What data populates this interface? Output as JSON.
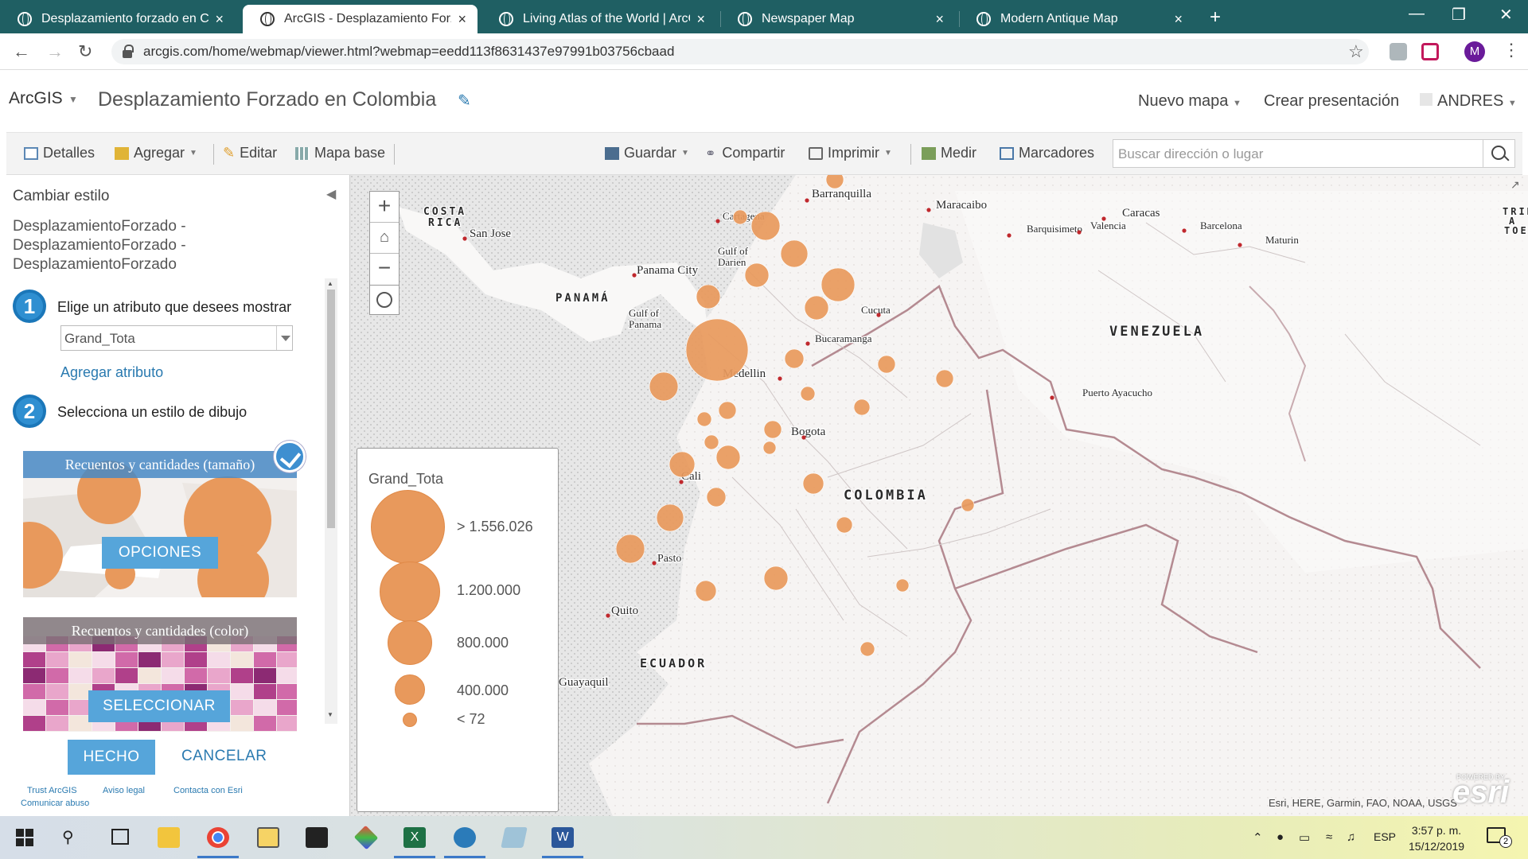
{
  "browser": {
    "tabs": [
      {
        "title": "Desplazamiento forzado en Colo",
        "close": "×",
        "active": false
      },
      {
        "title": "ArcGIS - Desplazamiento Forzado",
        "close": "×",
        "active": true
      },
      {
        "title": "Living Atlas of the World | ArcGIS",
        "close": "×",
        "active": false
      },
      {
        "title": "Newspaper Map",
        "close": "×",
        "active": false
      },
      {
        "title": "Modern Antique Map",
        "close": "×",
        "active": false
      }
    ],
    "new_tab": "+",
    "url": "arcgis.com/home/webmap/viewer.html?webmap=eedd113f8631437e97991b03756cbaad",
    "profile_initial": "M"
  },
  "header": {
    "logo": "ArcGIS",
    "title": "Desplazamiento Forzado en Colombia",
    "new_map": "Nuevo mapa",
    "create_presentation": "Crear presentación",
    "user": "ANDRES"
  },
  "toolbar": {
    "details": "Detalles",
    "add": "Agregar",
    "edit": "Editar",
    "basemap": "Mapa base",
    "save": "Guardar",
    "share": "Compartir",
    "print": "Imprimir",
    "measure": "Medir",
    "bookmarks": "Marcadores",
    "search_placeholder": "Buscar dirección o lugar"
  },
  "panel": {
    "title": "Cambiar estilo",
    "layer_lines": [
      "DesplazamientoForzado -",
      "DesplazamientoForzado -",
      "DesplazamientoForzado"
    ],
    "step1_num": "1",
    "step1_text": "Elige un atributo que desees mostrar",
    "attribute_value": "Grand_Tota",
    "add_attribute": "Agregar atributo",
    "step2_num": "2",
    "step2_text": "Selecciona un estilo de dibujo",
    "card1_label": "Recuentos y cantidades (tamaño)",
    "card1_button": "OPCIONES",
    "card2_label": "Recuentos y cantidades (color)",
    "card2_button": "SELECCIONAR",
    "done": "HECHO",
    "cancel": "CANCELAR",
    "footer": {
      "trust": "Trust ArcGIS",
      "legal": "Aviso legal",
      "contact": "Contacta con Esri",
      "report": "Comunicar abuso"
    }
  },
  "legend": {
    "title": "Grand_Tota",
    "items": [
      {
        "label": "> 1.556.026"
      },
      {
        "label": "1.200.000"
      },
      {
        "label": "800.000"
      },
      {
        "label": "400.000"
      },
      {
        "label": "< 72"
      }
    ]
  },
  "map": {
    "symbol_color": "#e8995c",
    "labels": {
      "costa_rica": [
        "COSTA",
        "RICA"
      ],
      "san_jose": "San Jose",
      "panama_city": "Panama City",
      "panama": "PANAMÁ",
      "gulf_panama": [
        "Gulf of",
        "Panama"
      ],
      "gulf_darien": [
        "Gulf of",
        "Darien"
      ],
      "barranquilla": "Barranquilla",
      "cartagena": "Cartagena",
      "maracaibo": "Maracaibo",
      "caracas": "Caracas",
      "barquisimeto": "Barquisimeto",
      "valencia": "Valencia",
      "barcelona": "Barcelona",
      "maturin": "Maturin",
      "trin": [
        "TRIN",
        "A",
        "TOE"
      ],
      "cucuta": "Cucuta",
      "bucaramanga": "Bucaramanga",
      "venezuela": "VENEZUELA",
      "medellin": "Medellin",
      "puerto_ayacucho": "Puerto Ayacucho",
      "bogota": "Bogota",
      "cali": "Cali",
      "colombia": "COLOMBIA",
      "pasto": "Pasto",
      "quito": "Quito",
      "ecuador": "ECUADOR",
      "guayaquil": "Guayaquil"
    },
    "attribution": "Esri, HERE, Garmin, FAO, NOAA, USGS",
    "esri": "esri",
    "powered_by": "POWERED BY"
  },
  "taskbar": {
    "lang": "ESP",
    "time": "3:57 p. m.",
    "date": "15/12/2019",
    "notifications": "2"
  }
}
